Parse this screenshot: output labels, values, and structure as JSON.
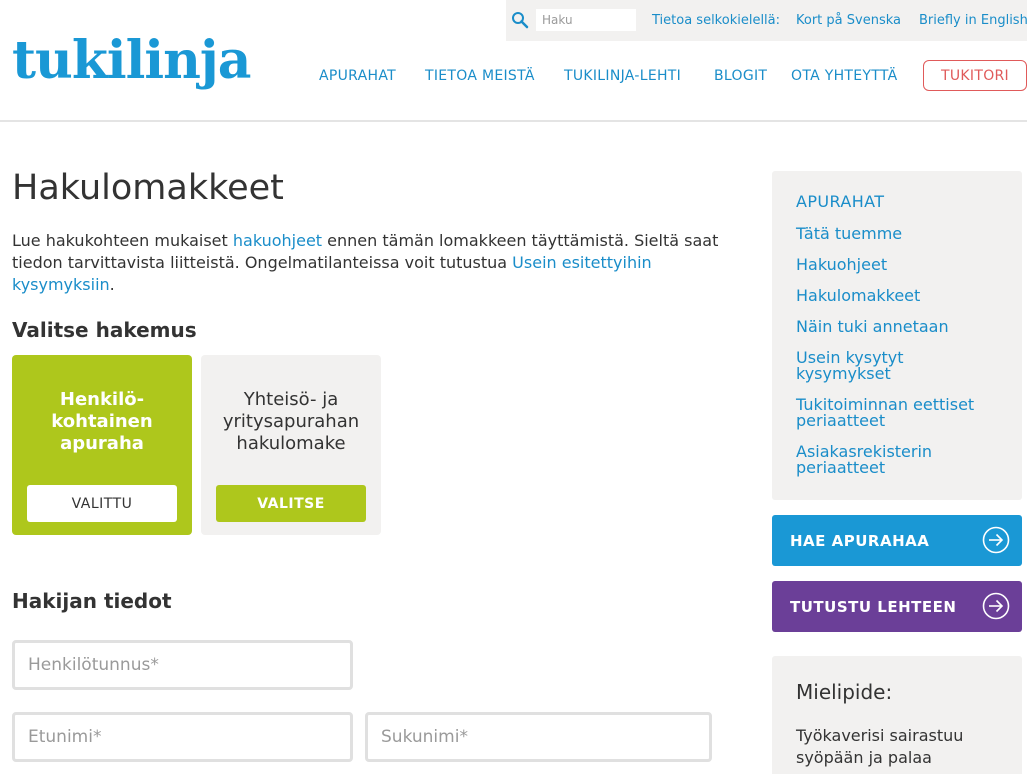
{
  "topbar": {
    "search_placeholder": "Haku",
    "links": [
      "Tietoa selkokielellä:",
      "Kort på Svenska",
      "Briefly in English"
    ]
  },
  "header": {
    "logo": "tukilinja",
    "nav": [
      "APURAHAT",
      "TIETOA MEISTÄ",
      "TUKILINJA-LEHTI",
      "BLOGIT",
      "OTA YHTEYTTÄ"
    ],
    "tukitori": "TUKITORI"
  },
  "main": {
    "title": "Hakulomakkeet",
    "intro": {
      "p1": "Lue hakukohteen mukaiset ",
      "link1": "hakuohjeet",
      "p2": " ennen tämän lomakkeen täyttämistä. Sieltä saat tiedon tarvittavista liitteistä. Ongelmatilanteissa voit tutustua ",
      "link2": "Usein esitettyihin kysymyksiin",
      "p3": "."
    },
    "choose_title": "Valitse hakemus",
    "cards": [
      {
        "title_lines": [
          "Henkilö-",
          "kohtainen",
          "apuraha"
        ],
        "button": "VALITTU",
        "selected": true
      },
      {
        "title_lines": [
          "Yhteisö- ja",
          "yritysapurahan",
          "hakulomake"
        ],
        "button": "VALITSE",
        "selected": false
      }
    ],
    "applicant_title": "Hakijan tiedot",
    "fields": {
      "ssn_placeholder": "Henkilötunnus*",
      "firstname_placeholder": "Etunimi*",
      "lastname_placeholder": "Sukunimi*"
    }
  },
  "sidebar": {
    "heading": "APURAHAT",
    "items": [
      "Tätä tuemme",
      "Hakuohjeet",
      "Hakulomakkeet",
      "Näin tuki annetaan",
      "Usein kysytyt kysymykset",
      "Tukitoiminnan eettiset periaatteet",
      "Asiakasrekisterin periaatteet"
    ],
    "cta_apply": "HAE APURAHAA",
    "cta_magazine": "TUTUSTU LEHTEEN",
    "opinion_title": "Mielipide:",
    "opinion_text": "Työkaverisi sairastuu syöpään ja palaa"
  },
  "colors": {
    "brand_blue": "#1a98d5",
    "link_blue": "#1a8dc9",
    "green": "#aec71c",
    "purple": "#6b3f98",
    "red": "#e05a5a",
    "panel_grey": "#f2f1f0"
  },
  "icons": {
    "search": "search-icon",
    "cta_arrow": "arrow-right-circle-icon"
  }
}
